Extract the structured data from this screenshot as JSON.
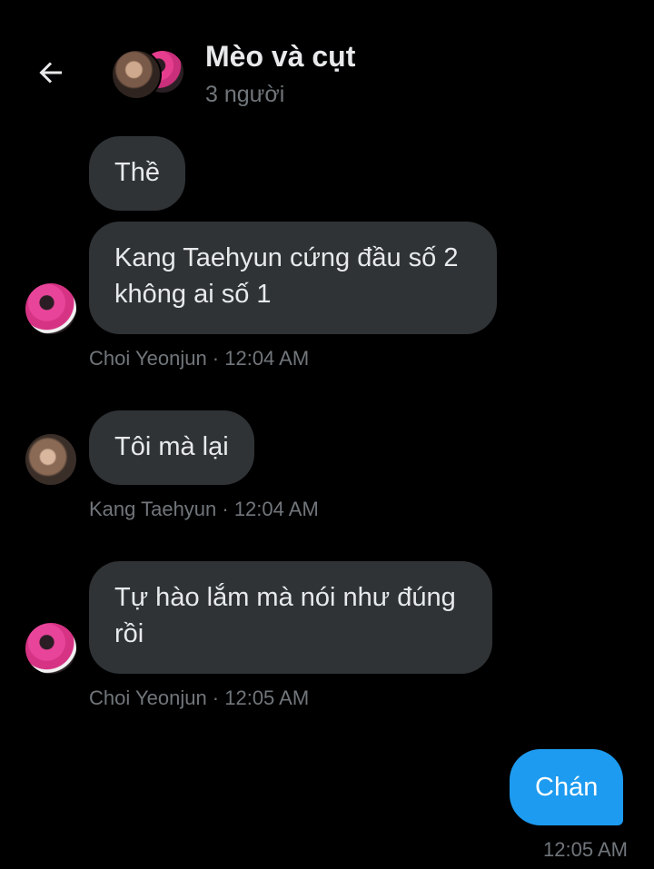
{
  "header": {
    "title": "Mèo và cụt",
    "subtitle": "3 người",
    "back_icon": "arrow-left-icon"
  },
  "messages": [
    {
      "text": "Thề",
      "direction": "incoming"
    },
    {
      "text": "Kang Taehyun cứng đầu số 2\nkhông ai số 1",
      "direction": "incoming",
      "meta": "Choi Yeonjun · 12:04 AM"
    },
    {
      "text": "Tôi mà lại",
      "direction": "incoming",
      "meta": "Kang Taehyun · 12:04 AM"
    },
    {
      "text": "Tự hào lắm mà nói như đúng\nrồi",
      "direction": "incoming",
      "meta": "Choi Yeonjun · 12:05 AM"
    },
    {
      "text": "Chán",
      "direction": "outgoing",
      "meta": "12:05 AM"
    }
  ],
  "colors": {
    "background": "#000000",
    "incoming_bubble": "#2f3336",
    "outgoing_bubble": "#1d9bf0",
    "primary_text": "#e7e9ea",
    "secondary_text": "#71767b"
  }
}
